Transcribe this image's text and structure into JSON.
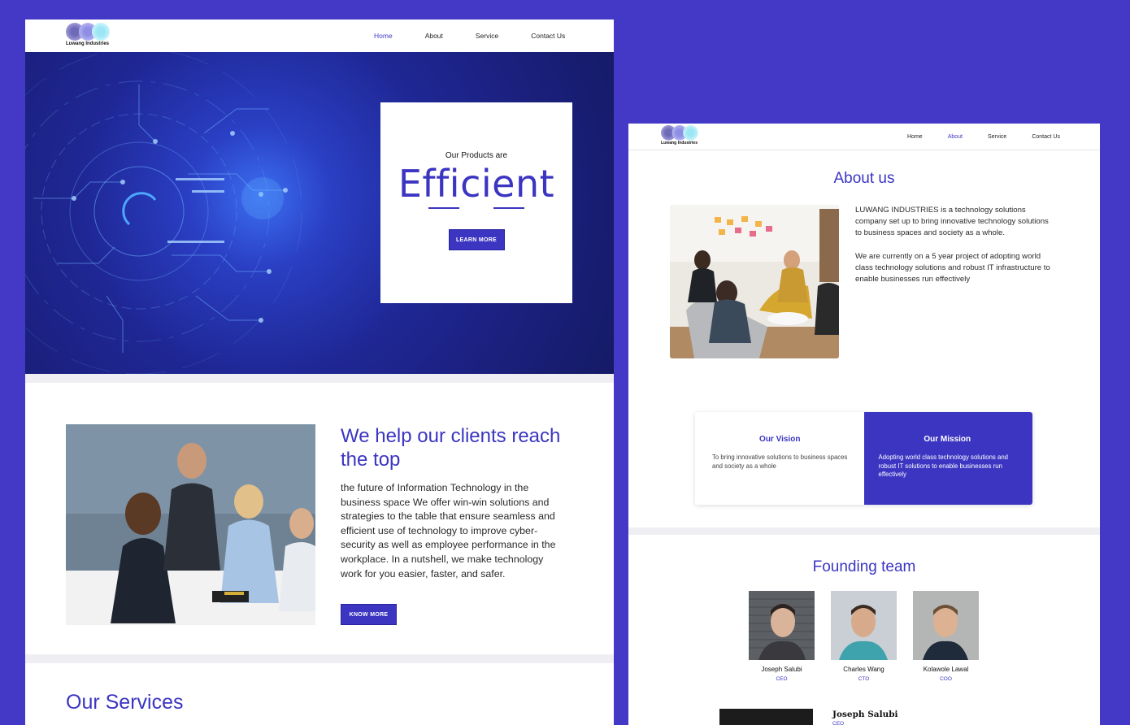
{
  "brand": {
    "name": "Luwang Industries",
    "primary_color": "#3b35c2",
    "background_color": "#4339c6"
  },
  "home": {
    "nav": [
      {
        "label": "Home",
        "active": true
      },
      {
        "label": "About",
        "active": false
      },
      {
        "label": "Service",
        "active": false
      },
      {
        "label": "Contact Us",
        "active": false
      }
    ],
    "hero": {
      "pretitle": "Our Products are",
      "headline": "Efficient",
      "button": "LEARN MORE"
    },
    "help": {
      "title": "We help our clients reach the top",
      "body": "the future of Information Technology in the business space We offer win-win solutions and strategies to the table that ensure seamless and efficient use of technology to improve cyber-security as well as employee performance in the workplace. In a nutshell, we make technology work for you easier, faster, and safer.",
      "button": "KNOW MORE"
    },
    "services_title": "Our Services"
  },
  "about": {
    "nav": [
      {
        "label": "Home",
        "active": false
      },
      {
        "label": "About",
        "active": true
      },
      {
        "label": "Service",
        "active": false
      },
      {
        "label": "Contact Us",
        "active": false
      }
    ],
    "title": "About us",
    "paragraph1": "LUWANG INDUSTRIES is a technology solutions company set up to bring innovative technology solutions to business spaces and society as a whole.",
    "paragraph2": "We are currently on a 5 year project of adopting world class technology solutions and robust IT infrastructure to enable businesses run effectively",
    "vision": {
      "title": "Our Vision",
      "text": "To bring innovative solutions to business spaces and society as a whole"
    },
    "mission": {
      "title": "Our Mission",
      "text": "Adopting world class technology solutions and robust IT solutions to enable businesses run effectively"
    },
    "team_title": "Founding team",
    "team": [
      {
        "name": "Joseph Salubi",
        "role": "CEO"
      },
      {
        "name": "Charles Wang",
        "role": "CTO"
      },
      {
        "name": "Kolawole Lawal",
        "role": "COO"
      }
    ],
    "team_detail": {
      "name": "Joseph Salubi",
      "role": "CEO"
    }
  }
}
